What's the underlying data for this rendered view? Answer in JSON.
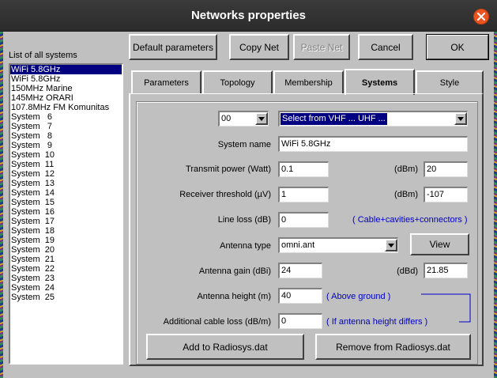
{
  "window": {
    "title": "Networks properties"
  },
  "toolbar": {
    "default_parameters": "Default parameters",
    "copy_net": "Copy Net",
    "paste_net": "Paste Net",
    "cancel": "Cancel",
    "ok": "OK"
  },
  "systems_list": {
    "label": "List of all systems",
    "selected_index": 0,
    "items": [
      "WiFi 5.8GHz",
      "WiFi 5.8GHz",
      "150MHz Marine",
      "145MHz ORARI",
      "107.8MHz FM Komunitas",
      "System   6",
      "System   7",
      "System   8",
      "System   9",
      "System  10",
      "System  11",
      "System  12",
      "System  13",
      "System  14",
      "System  15",
      "System  16",
      "System  17",
      "System  18",
      "System  19",
      "System  20",
      "System  21",
      "System  22",
      "System  23",
      "System  24",
      "System  25"
    ]
  },
  "tabs": [
    {
      "label": "Parameters",
      "active": false
    },
    {
      "label": "Topology",
      "active": false
    },
    {
      "label": "Membership",
      "active": false
    },
    {
      "label": "Systems",
      "active": true
    },
    {
      "label": "Style",
      "active": false
    }
  ],
  "systems_tab": {
    "index_combo": "00",
    "band_combo": "Select from VHF ... UHF ...",
    "system_name_label": "System name",
    "system_name": "WiFi 5.8GHz",
    "transmit_power_label": "Transmit power (Watt)",
    "transmit_power_watt": "0.1",
    "transmit_power_dbm_label": "(dBm)",
    "transmit_power_dbm": "20",
    "receiver_threshold_label": "Receiver threshold (µV)",
    "receiver_threshold_uv": "1",
    "receiver_threshold_dbm_label": "(dBm)",
    "receiver_threshold_dbm": "-107",
    "line_loss_label": "Line loss (dB)",
    "line_loss": "0",
    "line_loss_note": "( Cable+cavities+connectors )",
    "antenna_type_label": "Antenna type",
    "antenna_type": "omni.ant",
    "view_button": "View",
    "antenna_gain_label": "Antenna gain (dBi)",
    "antenna_gain_dbi": "24",
    "antenna_gain_dbd_label": "(dBd)",
    "antenna_gain_dbd": "21.85",
    "antenna_height_label": "Antenna height (m)",
    "antenna_height": "40",
    "antenna_height_note": "( Above ground )",
    "additional_cable_loss_label": "Additional cable loss (dB/m)",
    "additional_cable_loss": "0",
    "additional_cable_loss_note": "( If antenna height differs )",
    "add_button": "Add to Radiosys.dat",
    "remove_button": "Remove from Radiosys.dat"
  },
  "colors": {
    "titlebar": "#2c2c2c",
    "close_button": "#e95420",
    "window_face": "#c0c0c0",
    "selection": "#000080",
    "note_text": "#0000c8"
  }
}
